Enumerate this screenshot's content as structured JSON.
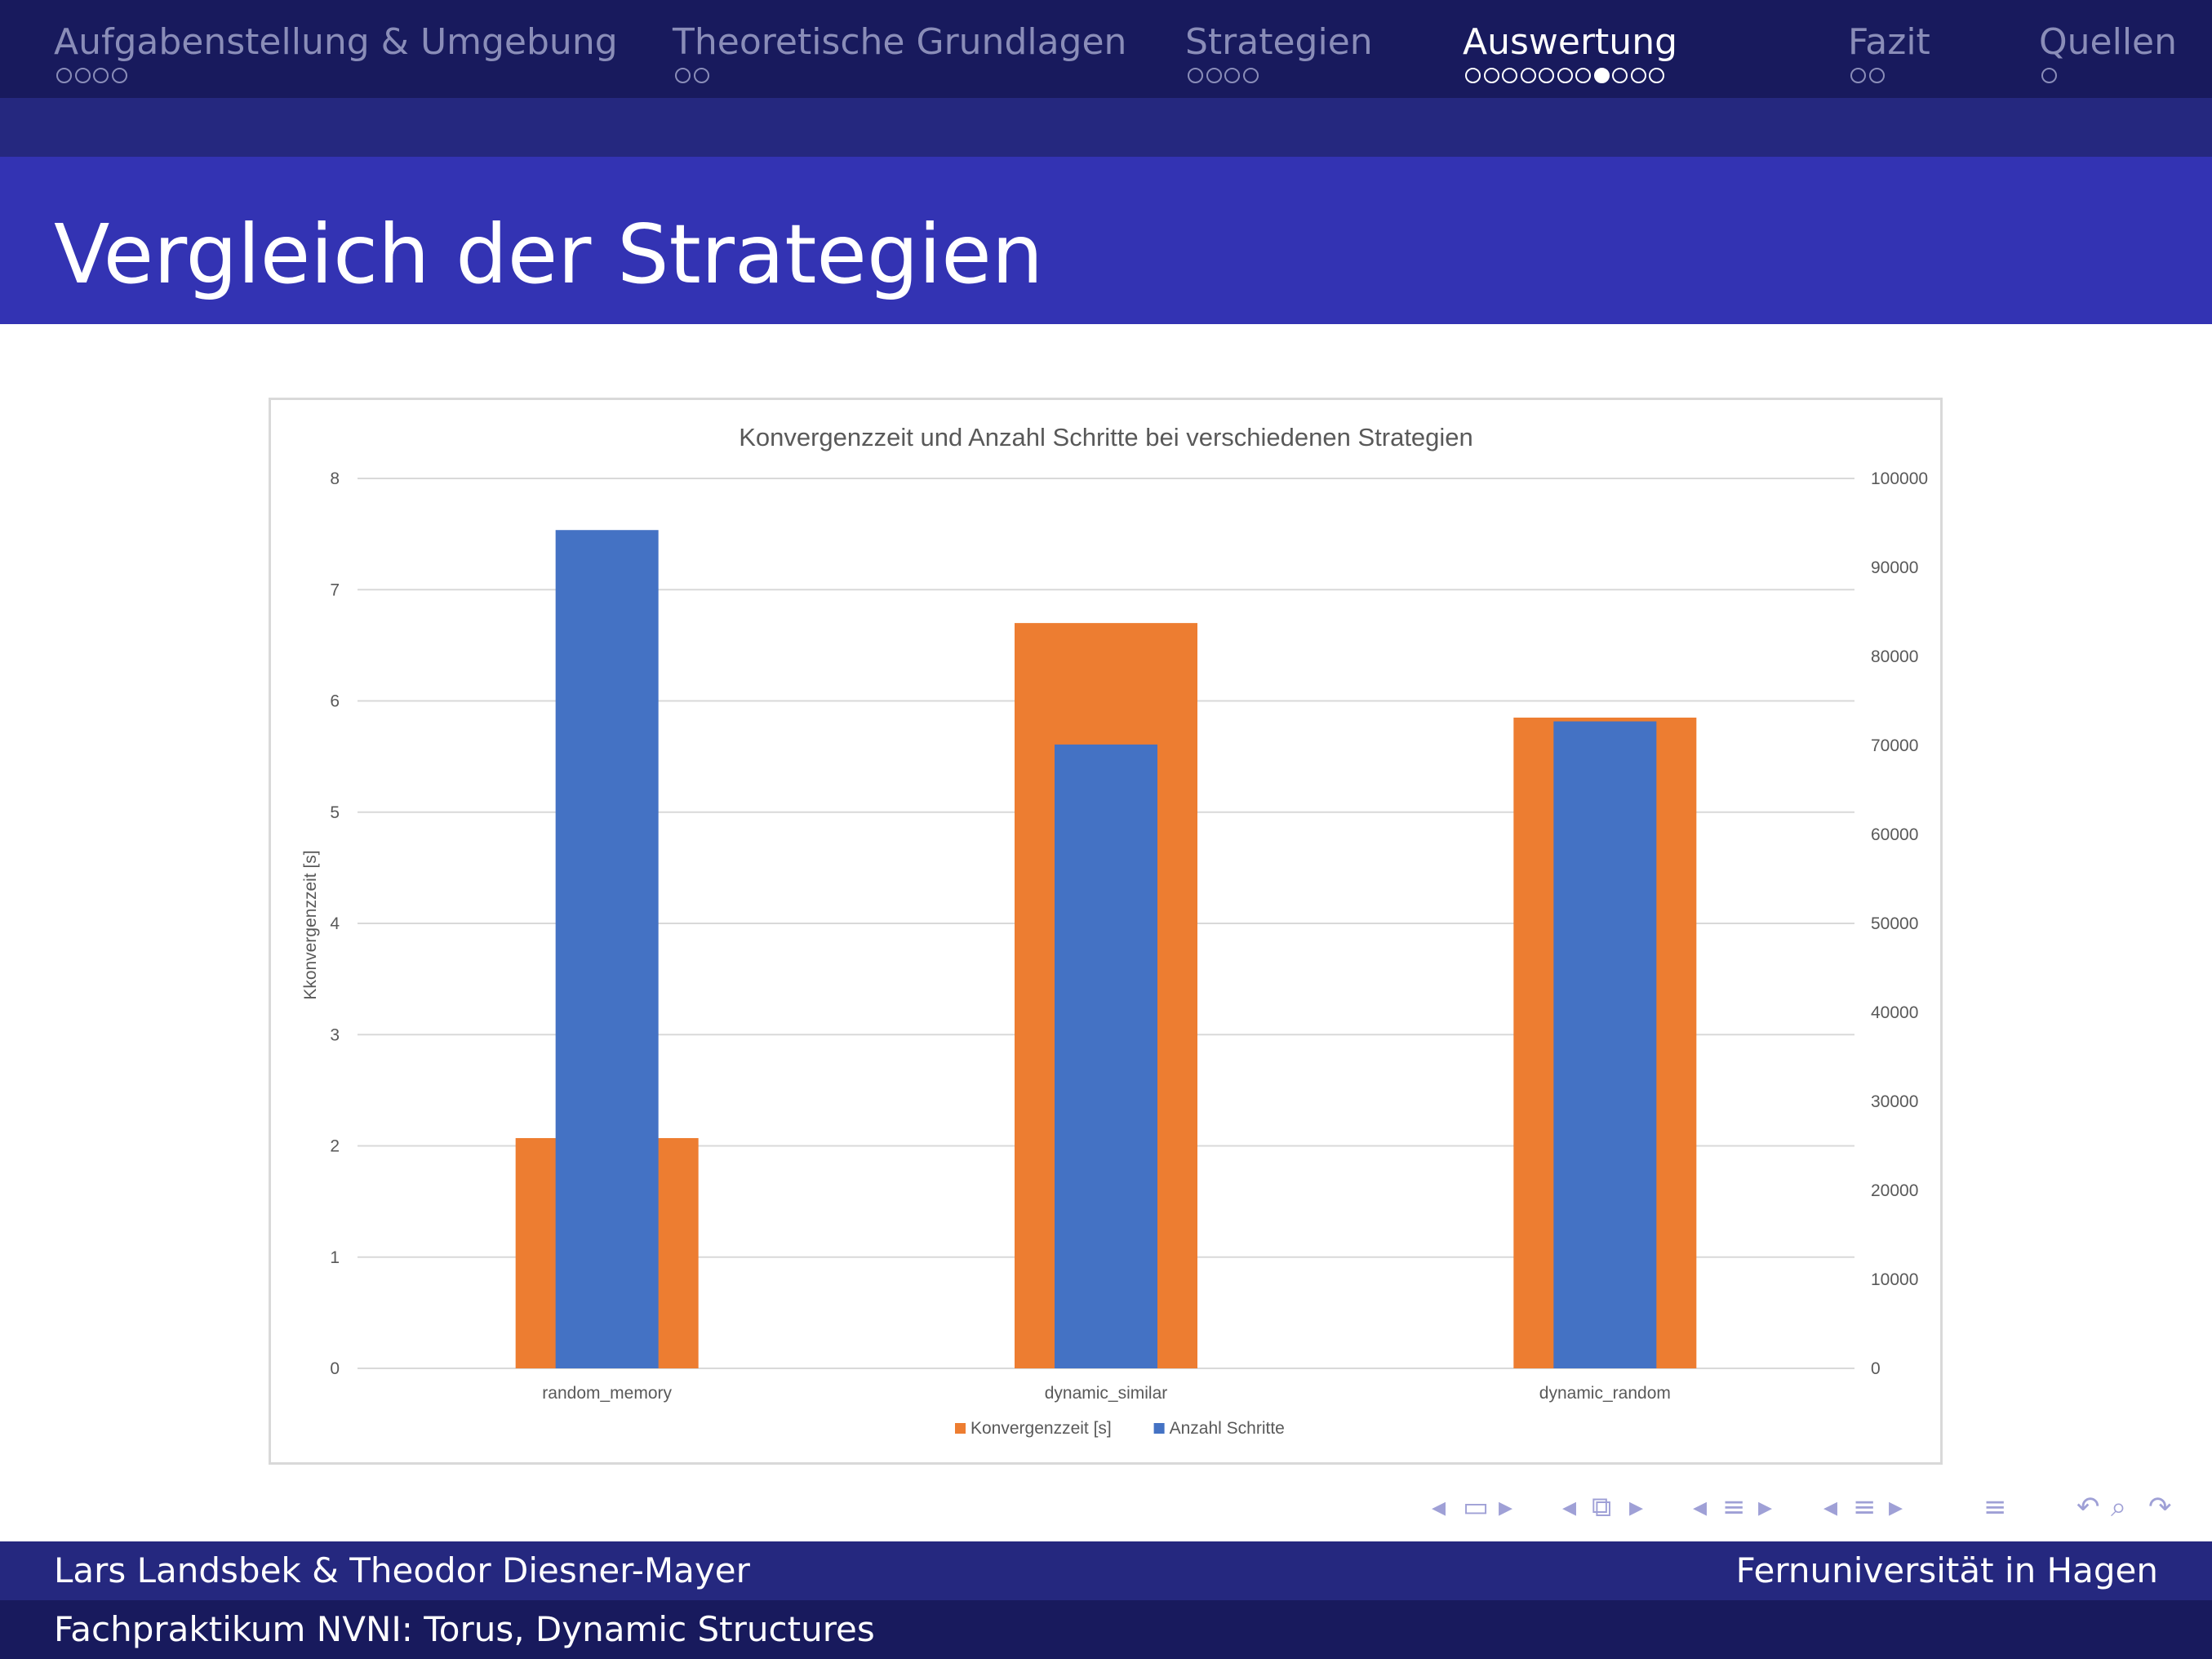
{
  "nav": {
    "sections": [
      {
        "label": "Aufgabenstellung & Umgebung",
        "dots": 4,
        "active": false
      },
      {
        "label": "Theoretische Grundlagen",
        "dots": 2,
        "active": false
      },
      {
        "label": "Strategien",
        "dots": 4,
        "active": false
      },
      {
        "label": "Auswertung",
        "dots": 11,
        "active": true,
        "current_dot": 8
      },
      {
        "label": "Fazit",
        "dots": 2,
        "active": false
      },
      {
        "label": "Quellen",
        "dots": 1,
        "active": false
      }
    ]
  },
  "frame": {
    "title": "Vergleich der Strategien"
  },
  "colors": {
    "nav_bg": "#181a5d",
    "strip_bg": "#25287f",
    "title_bg": "#3333b3",
    "series_orange": "#ed7d31",
    "series_blue": "#4472c4"
  },
  "chart_data": {
    "type": "bar",
    "title": "Konvergenzzeit und Anzahl Schritte bei verschiedenen Strategien",
    "categories": [
      "random_memory",
      "dynamic_similar",
      "dynamic_random"
    ],
    "ylabel": "Kkonvergenzzeit [s]",
    "ylabel_right": "",
    "ylim": [
      0,
      8
    ],
    "ylim_right": [
      0,
      100000
    ],
    "yticks": [
      "0",
      "1",
      "2",
      "3",
      "4",
      "5",
      "6",
      "7",
      "8"
    ],
    "yticks_right": [
      "0",
      "10000",
      "20000",
      "30000",
      "40000",
      "50000",
      "60000",
      "70000",
      "80000",
      "90000",
      "100000"
    ],
    "series": [
      {
        "name": "Konvergenzzeit [s]",
        "axis": "left",
        "color": "#ed7d31",
        "values": [
          2.07,
          6.7,
          5.85
        ]
      },
      {
        "name": "Anzahl Schritte",
        "axis": "right",
        "color": "#4472c4",
        "values": [
          94200,
          70100,
          72700
        ]
      }
    ],
    "grid": true,
    "legend": "bottom"
  },
  "navigation_symbols": [
    "◂",
    "▭",
    "▸",
    "◂",
    "⧉",
    "▸",
    "◂",
    "≡",
    "▸",
    "◂",
    "≡",
    "▸",
    "≡",
    "↶",
    "⌕",
    "↷"
  ],
  "footer": {
    "authors": "Lars Landsbek & Theodor Diesner-Mayer",
    "institute": "Fernuniversität in Hagen",
    "course": "Fachpraktikum NVNI: Torus, Dynamic Structures"
  }
}
